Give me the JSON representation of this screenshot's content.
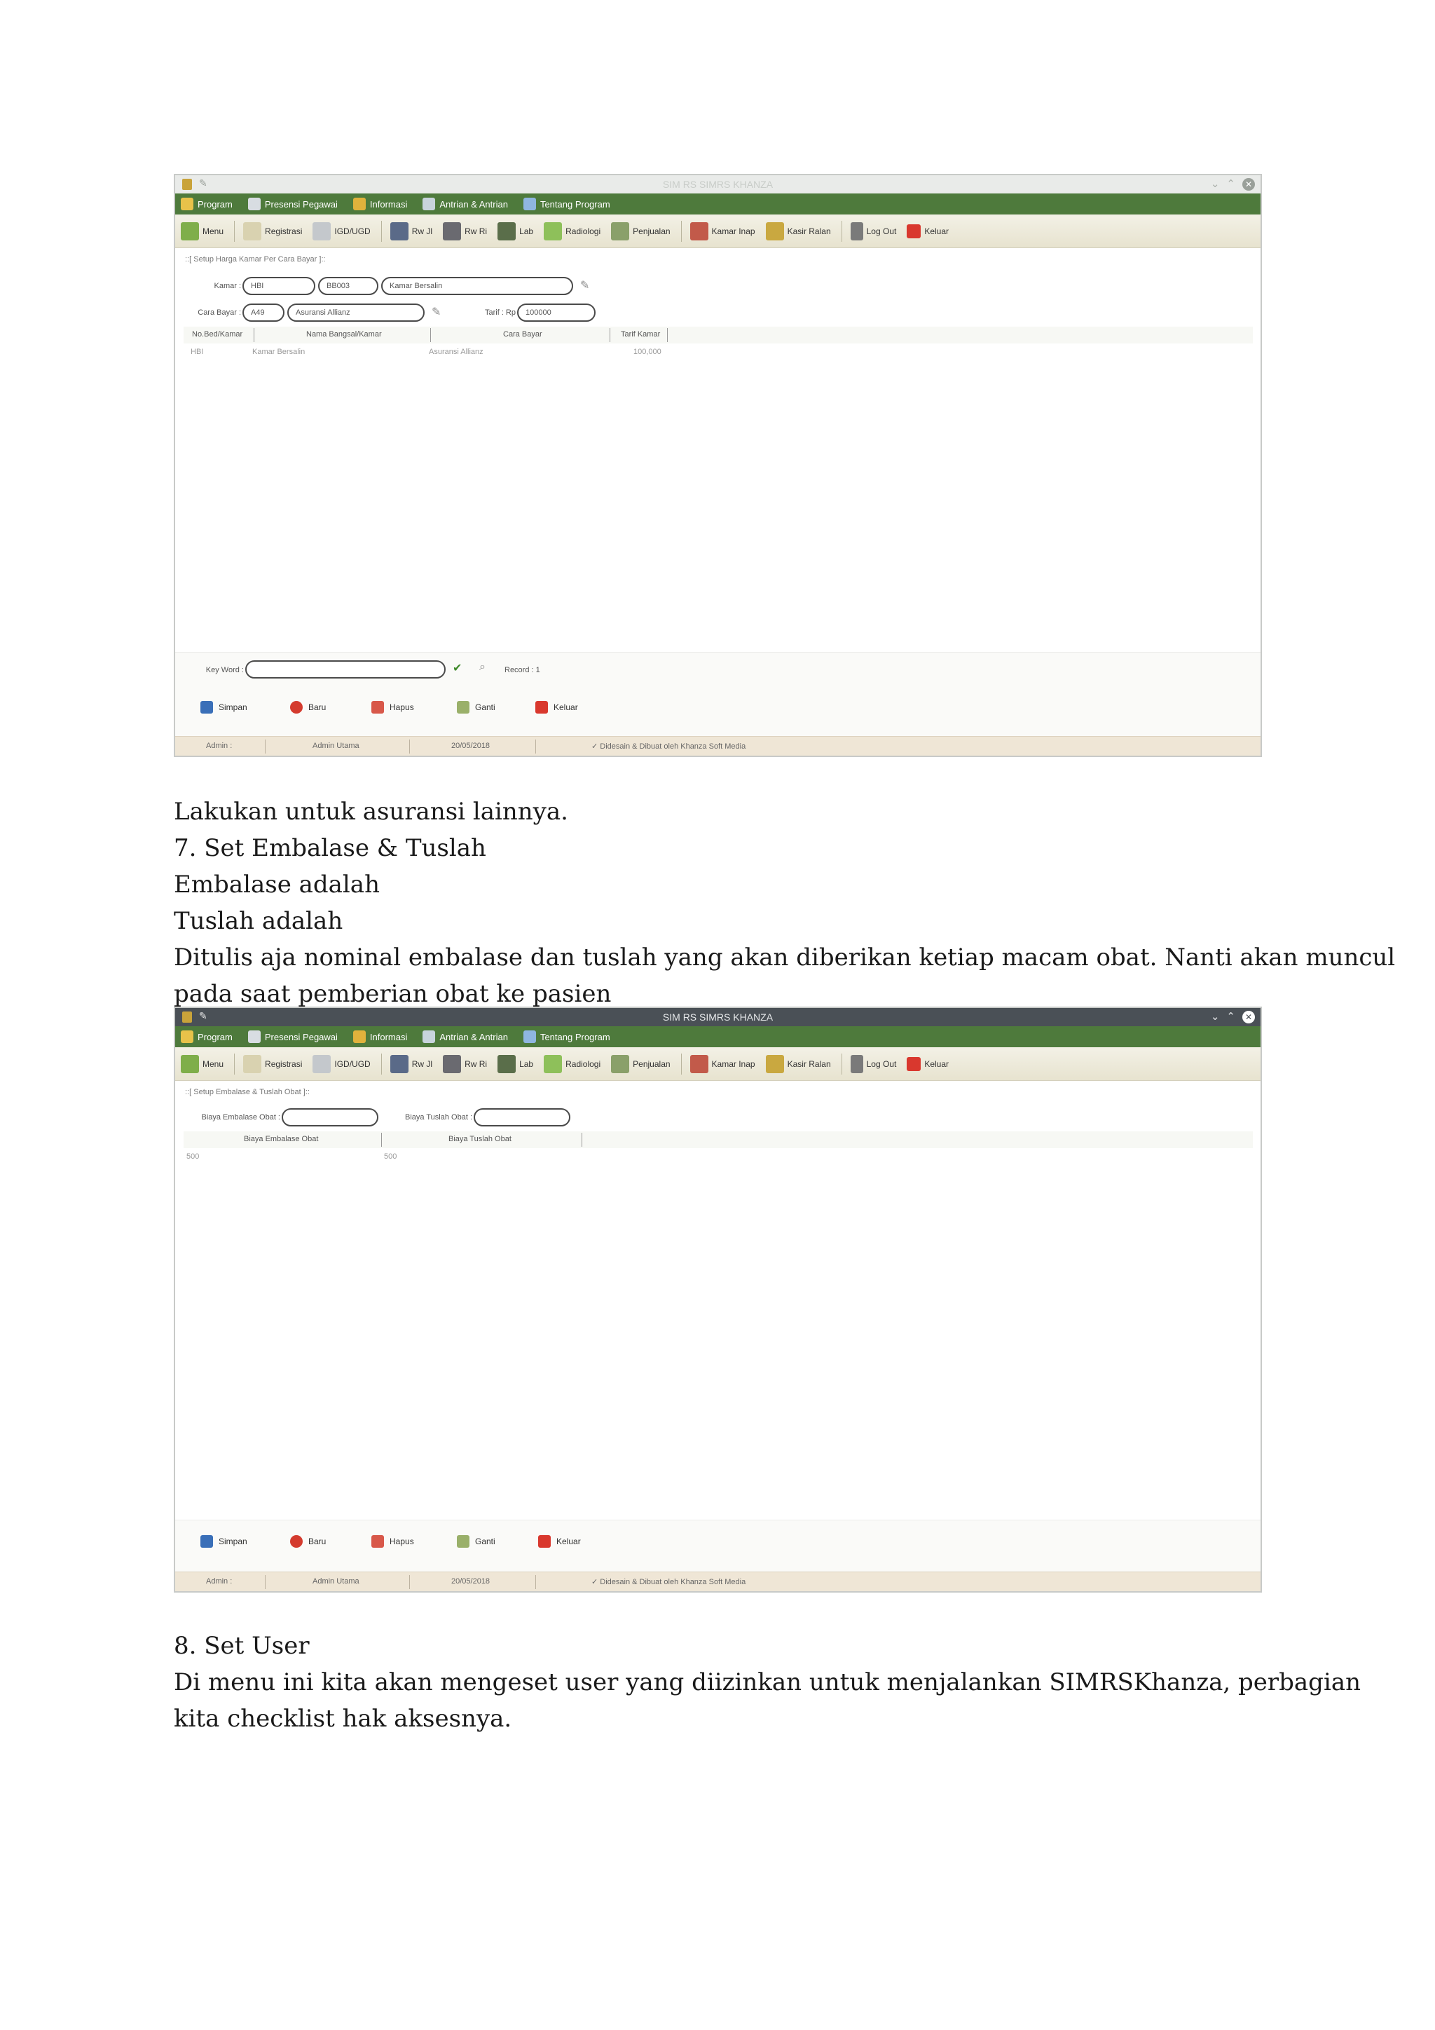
{
  "app": {
    "title": "SIM RS SIMRS KHANZA",
    "menu": [
      "Program",
      "Presensi Pegawai",
      "Informasi",
      "Antrian & Antrian",
      "Tentang Program"
    ],
    "toolbar": [
      "Menu",
      "Registrasi",
      "IGD/UGD",
      "Rw Jl",
      "Rw Ri",
      "Lab",
      "Radiologi",
      "Penjualan",
      "Kamar Inap",
      "Kasir Ralan",
      "Log Out",
      "Keluar"
    ],
    "buttons": [
      "Simpan",
      "Baru",
      "Hapus",
      "Ganti",
      "Keluar"
    ],
    "status": {
      "user": "Admin :",
      "name": "Admin Utama",
      "date": "20/05/2018",
      "credit": "Didesain & Dibuat oleh Khanza Soft Media"
    }
  },
  "screen1": {
    "panel_title": "Setup Harga Kamar Per Cara Bayar",
    "form": {
      "kamar_label": "Kamar :",
      "kamar_code1": "HBI",
      "kamar_code2": "BB003",
      "kamar_name": "Kamar Bersalin",
      "cara_bayar_label": "Cara Bayar :",
      "cara_bayar_code": "A49",
      "cara_bayar_name": "Asuransi Allianz",
      "tarif_label": "Tarif : Rp",
      "tarif_value": "100000"
    },
    "table": {
      "columns": [
        "No.Bed/Kamar",
        "Nama Bangsal/Kamar",
        "Cara Bayar",
        "Tarif Kamar"
      ],
      "rows": [
        [
          "HBI",
          "Kamar Bersalin",
          "Asuransi Allianz",
          "100,000"
        ]
      ]
    },
    "search": {
      "label": "Key Word :",
      "record": "Record : 1"
    }
  },
  "doc": {
    "line1": "Lakukan untuk asuransi lainnya.",
    "line2": "7. Set Embalase & Tuslah",
    "line3": "Embalase adalah",
    "line4": "Tuslah adalah",
    "line5": "Ditulis aja nominal embalase dan tuslah yang akan diberikan ketiap macam obat. Nanti akan muncul",
    "line6": "pada saat pemberian obat ke pasien",
    "line7": "8. Set User",
    "line8": "Di menu ini kita akan mengeset user yang diizinkan untuk menjalankan SIMRSKhanza, perbagian",
    "line9": "kita checklist hak aksesnya."
  },
  "screen2": {
    "panel_title": "Setup Embalase & Tuslah Obat",
    "form": {
      "embalase_label": "Biaya Embalase Obat :",
      "tuslah_label": "Biaya Tuslah Obat :"
    },
    "table": {
      "columns": [
        "Biaya Embalase Obat",
        "Biaya Tuslah Obat"
      ],
      "rows": [
        [
          "500",
          "500"
        ]
      ]
    }
  },
  "colors": {
    "menubar": "#4e7a3c",
    "toolbar": "#efece0",
    "statusbar": "#efe6d6",
    "titlebar_dark": "#4a5056"
  }
}
